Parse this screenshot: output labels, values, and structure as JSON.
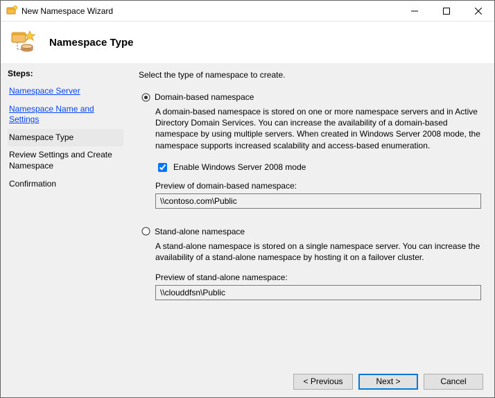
{
  "window": {
    "title": "New Namespace Wizard"
  },
  "header": {
    "title": "Namespace Type"
  },
  "sidebar": {
    "label": "Steps:",
    "items": [
      {
        "label": "Namespace Server",
        "kind": "link"
      },
      {
        "label": "Namespace Name and Settings",
        "kind": "link"
      },
      {
        "label": "Namespace Type",
        "kind": "current"
      },
      {
        "label": "Review Settings and Create Namespace",
        "kind": "plain"
      },
      {
        "label": "Confirmation",
        "kind": "plain"
      }
    ]
  },
  "main": {
    "instruction": "Select the type of namespace to create.",
    "domain": {
      "radio_label": "Domain-based namespace",
      "selected": true,
      "desc": "A domain-based namespace is stored on one or more namespace servers and in Active Directory Domain Services. You can increase the availability of a domain-based namespace by using multiple servers. When created in Windows Server 2008 mode, the namespace supports increased scalability and access-based enumeration.",
      "checkbox_label": "Enable Windows Server 2008 mode",
      "checkbox_checked": true,
      "preview_label": "Preview of domain-based namespace:",
      "preview_value": "\\\\contoso.com\\Public"
    },
    "standalone": {
      "radio_label": "Stand-alone namespace",
      "selected": false,
      "desc": "A stand-alone namespace is stored on a single namespace server. You can increase the availability of a stand-alone namespace by hosting it on a failover cluster.",
      "preview_label": "Preview of stand-alone namespace:",
      "preview_value": "\\\\clouddfsn\\Public"
    }
  },
  "footer": {
    "previous": "< Previous",
    "next": "Next >",
    "cancel": "Cancel"
  }
}
